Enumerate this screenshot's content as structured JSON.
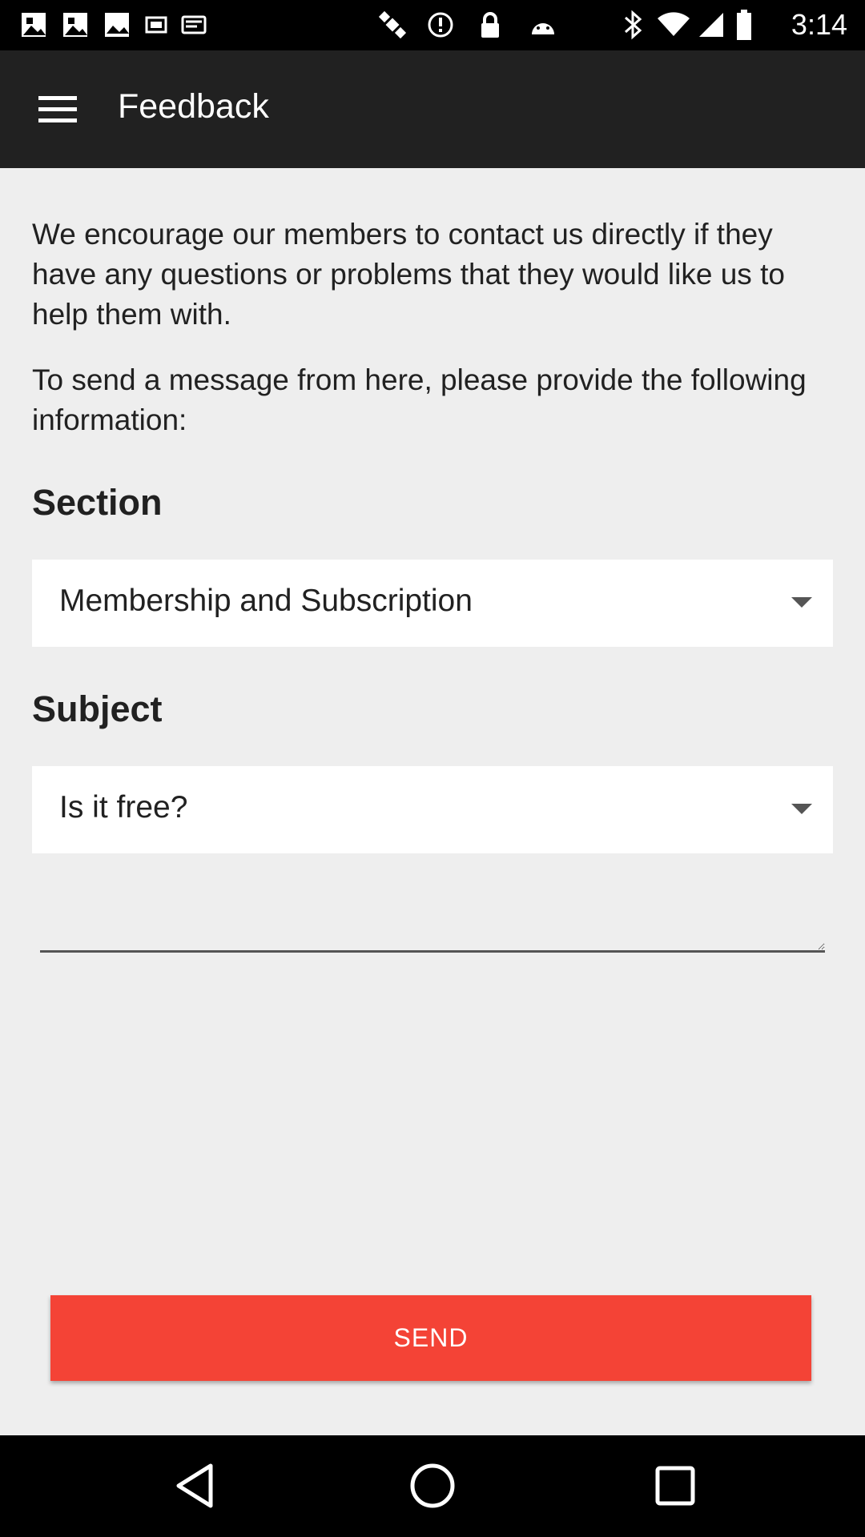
{
  "status_bar": {
    "time": "3:14",
    "icons": [
      "photo-icon",
      "photo-icon",
      "fake-gps-icon",
      "notification-icon",
      "satellite-icon",
      "alert-icon",
      "lock-icon",
      "android-icon",
      "bluetooth-icon",
      "wifi-icon",
      "signal-icon",
      "battery-icon"
    ]
  },
  "app_bar": {
    "title": "Feedback",
    "menu_icon": "hamburger-menu-icon"
  },
  "intro": {
    "paragraph1": "We encourage our members to contact us directly if they have any questions or problems that they would like us to help them with.",
    "paragraph2": "To send a message from here, please provide the following information:"
  },
  "form": {
    "section_label": "Section",
    "section_value": "Membership and Subscription",
    "subject_label": "Subject",
    "subject_value": "Is it free?",
    "message_value": "",
    "send_label": "SEND"
  },
  "nav_bar": {
    "buttons": [
      "back-icon",
      "home-icon",
      "recents-icon"
    ]
  },
  "colors": {
    "app_bar": "#212121",
    "background": "#eeeeee",
    "accent": "#f44336"
  }
}
